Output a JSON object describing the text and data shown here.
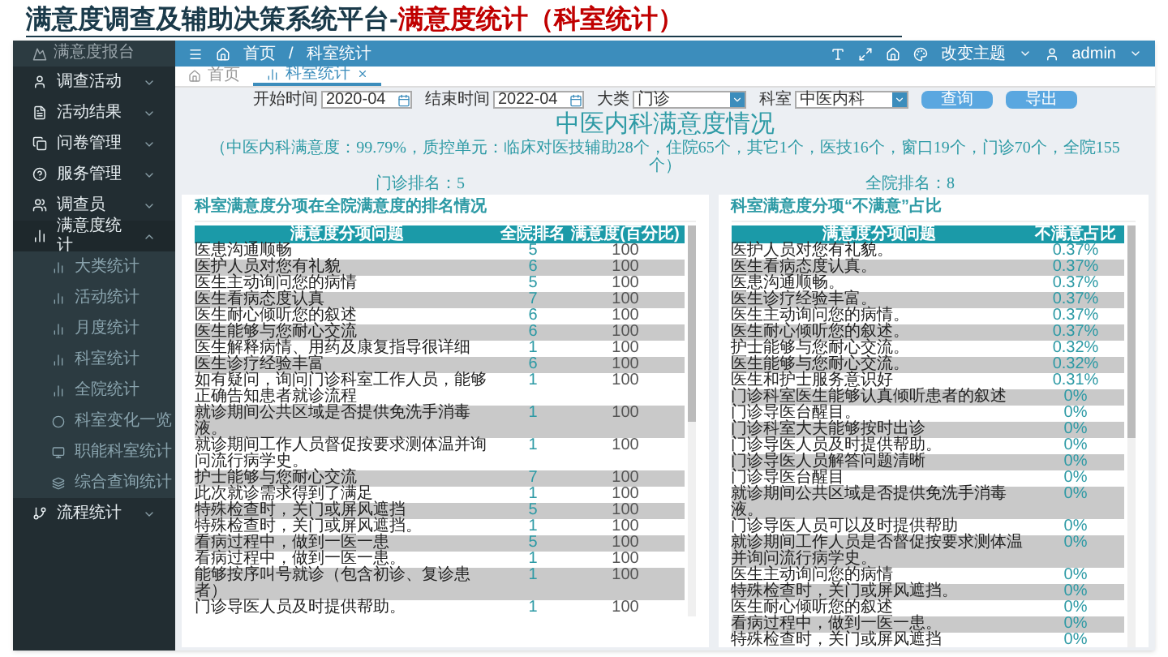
{
  "slide": {
    "title": "满意度调查及辅助决策系统平台-",
    "title_highlight": "满意度统计（科室统计）"
  },
  "sidebar": {
    "brand": "满意度报台",
    "items": [
      {
        "label": "调查活动",
        "expanded": false
      },
      {
        "label": "活动结果",
        "expanded": false
      },
      {
        "label": "问卷管理",
        "expanded": false
      },
      {
        "label": "服务管理",
        "expanded": false
      },
      {
        "label": "调查员",
        "expanded": false
      },
      {
        "label": "满意度统计",
        "expanded": true,
        "children": [
          {
            "label": "大类统计"
          },
          {
            "label": "活动统计"
          },
          {
            "label": "月度统计"
          },
          {
            "label": "科室统计"
          },
          {
            "label": "全院统计"
          },
          {
            "label": "科室变化一览"
          },
          {
            "label": "职能科室统计"
          },
          {
            "label": "综合查询统计"
          }
        ]
      },
      {
        "label": "流程统计",
        "expanded": false
      }
    ]
  },
  "header": {
    "breadcrumb": [
      "首页",
      "/",
      "科室统计"
    ],
    "theme": "改变主题",
    "user": "admin"
  },
  "tabs": [
    {
      "label": "首页",
      "selected": false
    },
    {
      "label": "科室统计",
      "selected": true
    }
  ],
  "filters": [
    {
      "kind": "date",
      "label": "开始时间",
      "value": "2020-04"
    },
    {
      "kind": "date",
      "label": "结束时间",
      "value": "2022-04"
    },
    {
      "kind": "select",
      "label": "大类",
      "value": "门诊"
    },
    {
      "kind": "select",
      "label": "科室",
      "value": "中医内科"
    }
  ],
  "buttons": [
    "查询",
    "导出"
  ],
  "report": {
    "title": "中医内科满意度情况",
    "summary": "（中医内科满意度：99.79%，质控单元：临床对医技辅助28个，住院65个，其它1个，医技16个，窗口19个，门诊70个，全院155个）",
    "ranks": [
      "门诊排名：5",
      "全院排名：8"
    ],
    "panels": [
      {
        "title": "科室满意度分项在全院满意度的排名情况",
        "columns": [
          "满意度分项问题",
          "全院排名",
          "满意度(百分比)"
        ],
        "rows": [
          [
            "医患沟通顺畅",
            "5",
            "100"
          ],
          [
            "医护人员对您有礼貌",
            "6",
            "100"
          ],
          [
            "医生主动询问您的病情",
            "5",
            "100"
          ],
          [
            "医生看病态度认真",
            "7",
            "100"
          ],
          [
            "医生耐心倾听您的叙述",
            "6",
            "100"
          ],
          [
            "医生能够与您耐心交流",
            "6",
            "100"
          ],
          [
            "医生解释病情、用药及康复指导很详细",
            "1",
            "100"
          ],
          [
            "医生诊疗经验丰富",
            "6",
            "100"
          ],
          [
            "如有疑问，询问门诊科室工作人员，能够正确告知患者就诊流程",
            "1",
            "100"
          ],
          [
            "就诊期间公共区域是否提供免洗手消毒液。",
            "1",
            "100"
          ],
          [
            "就诊期间工作人员督促按要求测体温并询问流行病学史。",
            "1",
            "100"
          ],
          [
            "护士能够与您耐心交流",
            "7",
            "100"
          ],
          [
            "此次就诊需求得到了满足",
            "1",
            "100"
          ],
          [
            "特殊检查时，关门或屏风遮挡",
            "5",
            "100"
          ],
          [
            "特殊检查时，关门或屏风遮挡。",
            "1",
            "100"
          ],
          [
            "看病过程中，做到一医一患",
            "5",
            "100"
          ],
          [
            "看病过程中，做到一医一患。",
            "1",
            "100"
          ],
          [
            "能够按序叫号就诊（包含初诊、复诊患者）",
            "1",
            "100"
          ],
          [
            "门诊导医人员及时提供帮助。",
            "1",
            "100"
          ]
        ]
      },
      {
        "title": "科室满意度分项“不满意”占比",
        "columns": [
          "满意度分项问题",
          "不满意占比"
        ],
        "rows": [
          [
            "医护人员对您有礼貌。",
            "0.37%"
          ],
          [
            "医生看病态度认真。",
            "0.37%"
          ],
          [
            "医患沟通顺畅。",
            "0.37%"
          ],
          [
            "医生诊疗经验丰富。",
            "0.37%"
          ],
          [
            "医生主动询问您的病情。",
            "0.37%"
          ],
          [
            "医生耐心倾听您的叙述。",
            "0.37%"
          ],
          [
            "护士能够与您耐心交流。",
            "0.32%"
          ],
          [
            "医生能够与您耐心交流。",
            "0.32%"
          ],
          [
            "医生和护士服务意识好",
            "0.31%"
          ],
          [
            "门诊科室医生能够认真倾听患者的叙述",
            "0%"
          ],
          [
            "门诊导医台醒目。",
            "0%"
          ],
          [
            "门诊科室大夫能够按时出诊",
            "0%"
          ],
          [
            "门诊导医人员及时提供帮助。",
            "0%"
          ],
          [
            "门诊导医人员解答问题清晰",
            "0%"
          ],
          [
            "门诊导医台醒目",
            "0%"
          ],
          [
            "就诊期间公共区域是否提供免洗手消毒液。",
            "0%"
          ],
          [
            "门诊导医人员可以及时提供帮助",
            "0%"
          ],
          [
            "就诊期间工作人员是否督促按要求测体温并询问流行病学史。",
            "0%"
          ],
          [
            "医生主动询问您的病情",
            "0%"
          ],
          [
            "特殊检查时，关门或屏风遮挡。",
            "0%"
          ],
          [
            "医生耐心倾听您的叙述",
            "0%"
          ],
          [
            "看病过程中，做到一医一患。",
            "0%"
          ],
          [
            "特殊检查时，关门或屏风遮挡",
            "0%"
          ]
        ]
      }
    ]
  }
}
